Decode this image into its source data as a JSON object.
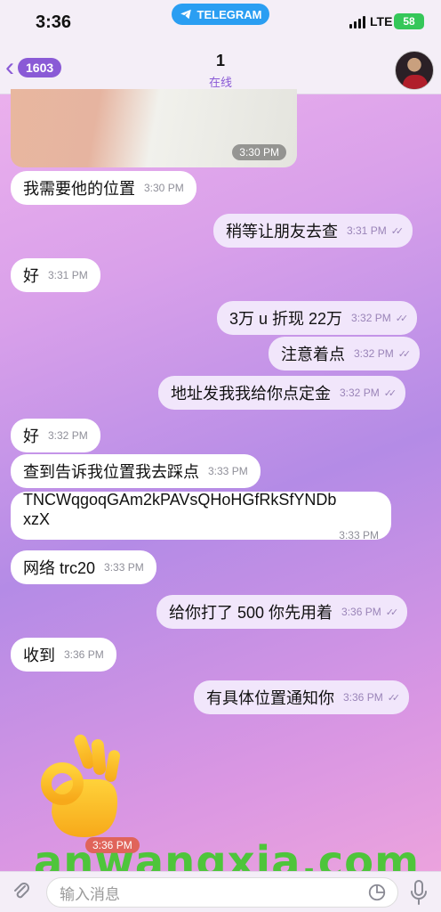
{
  "status": {
    "time": "3:36",
    "app_pill": "TELEGRAM",
    "network": "LTE",
    "battery": "58"
  },
  "header": {
    "back_count": "1603",
    "title": "1",
    "subtitle": "在线"
  },
  "photo": {
    "time": "3:30 PM"
  },
  "messages": [
    {
      "dir": "in",
      "text": "我需要他的位置",
      "time": "3:30 PM"
    },
    {
      "dir": "out",
      "text": "稍等让朋友去查",
      "time": "3:31 PM"
    },
    {
      "dir": "in",
      "text": "好",
      "time": "3:31 PM"
    },
    {
      "dir": "out",
      "text": "3万 u 折现 22万",
      "time": "3:32 PM"
    },
    {
      "dir": "out",
      "text": "注意着点",
      "time": "3:32 PM"
    },
    {
      "dir": "out",
      "text": "地址发我我给你点定金",
      "time": "3:32 PM"
    },
    {
      "dir": "in",
      "text": "好",
      "time": "3:32 PM"
    },
    {
      "dir": "in",
      "text": "查到告诉我位置我去踩点",
      "time": "3:33 PM"
    },
    {
      "dir": "in",
      "text": "TNCWqgoqGAm2kPAVsQHoHGfRkSfYNDbxzX",
      "time": "3:33 PM"
    },
    {
      "dir": "in",
      "text": "网络 trc20",
      "time": "3:33 PM"
    },
    {
      "dir": "out",
      "text": "给你打了 500 你先用着",
      "time": "3:36 PM"
    },
    {
      "dir": "in",
      "text": "收到",
      "time": "3:36 PM"
    },
    {
      "dir": "out",
      "text": "有具体位置通知你",
      "time": "3:36 PM"
    }
  ],
  "sticker": {
    "name": "ok-hand-emoji",
    "time": "3:36 PM"
  },
  "watermark": "anwangxia.com",
  "composer": {
    "placeholder": "输入消息"
  },
  "colors": {
    "accent": "#8a5ad6",
    "telegram_blue": "#2a9ef2",
    "battery_green": "#35c759",
    "watermark_green": "#4ec53b"
  }
}
